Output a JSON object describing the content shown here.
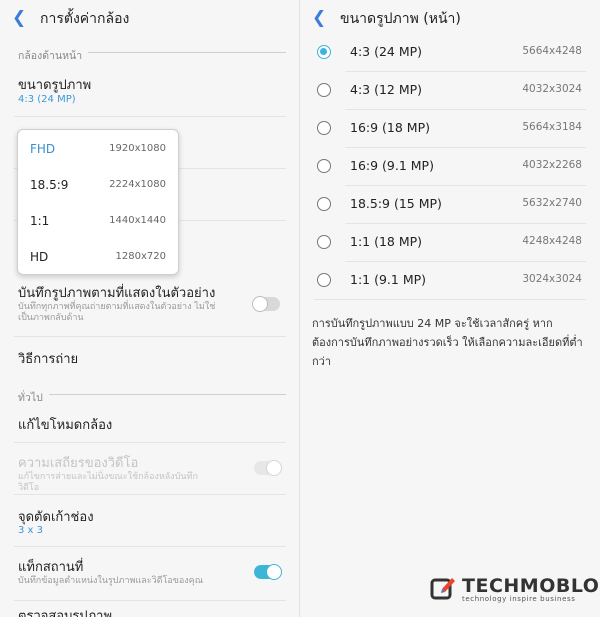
{
  "left": {
    "header": {
      "back_icon": "chevron-left-icon",
      "title": "การตั้งค่ากล้อง"
    },
    "section_rear": "กล้องด้านหน้า",
    "picture_size": {
      "title": "ขนาดรูปภาพ",
      "value": "4:3 (24 MP)"
    },
    "video_popup": [
      {
        "name": "FHD",
        "res": "1920x1080",
        "selected": true
      },
      {
        "name": "18.5:9",
        "res": "2224x1080",
        "selected": false
      },
      {
        "name": "1:1",
        "res": "1440x1440",
        "selected": false
      },
      {
        "name": "HD",
        "res": "1280x720",
        "selected": false
      }
    ],
    "save_as_preview": {
      "title": "บันทึกรูปภาพตามที่แสดงในตัวอย่าง",
      "desc": "บันทึกทุกภาพที่คุณถ่ายตามที่แสดงในตัวอย่าง ไม่ใช่เป็นภาพกลับด้าน",
      "enabled": false
    },
    "shooting_methods": "วิธีการถ่าย",
    "section_general": "ทั่วไป",
    "edit_modes": "แก้ไขโหมดกล้อง",
    "video_stabilization": {
      "title": "ความเสถียรของวิดีโอ",
      "desc": "แก้ไขการส่ายและไม่นิ่งขณะใช้กล้องหลังบันทึกวิดีโอ",
      "enabled": true,
      "disabled": true
    },
    "grid_lines": {
      "title": "จุดตัดเก้าช่อง",
      "value": "3 x 3"
    },
    "location_tags": {
      "title": "แท็กสถานที่",
      "desc": "บันทึกข้อมูลตำแหน่งในรูปภาพและวิดีโอของคุณ",
      "enabled": true
    },
    "review_pictures": "ตรวจสอบรูปภาพ"
  },
  "right": {
    "header": {
      "back_icon": "chevron-left-icon",
      "title": "ขนาดรูปภาพ (หน้า)"
    },
    "options": [
      {
        "label": "4:3 (24 MP)",
        "res": "5664x4248",
        "selected": true
      },
      {
        "label": "4:3 (12 MP)",
        "res": "4032x3024",
        "selected": false
      },
      {
        "label": "16:9 (18 MP)",
        "res": "5664x3184",
        "selected": false
      },
      {
        "label": "16:9 (9.1 MP)",
        "res": "4032x2268",
        "selected": false
      },
      {
        "label": "18.5:9 (15 MP)",
        "res": "5632x2740",
        "selected": false
      },
      {
        "label": "1:1 (18 MP)",
        "res": "4248x4248",
        "selected": false
      },
      {
        "label": "1:1 (9.1 MP)",
        "res": "3024x3024",
        "selected": false
      }
    ],
    "description": "การบันทึกรูปภาพแบบ 24 MP จะใช้เวลาสักครู่ หากต้องการบันทึกภาพอย่างรวดเร็ว ให้เลือกความละเอียดที่ต่ำกว่า"
  },
  "watermark": {
    "brand": "TECHMOBLOG",
    "tagline": "technology inspire business"
  },
  "colors": {
    "accent": "#3a98d8",
    "toggle_on": "#3db5d6",
    "radio_selected": "#3ab4e0"
  }
}
